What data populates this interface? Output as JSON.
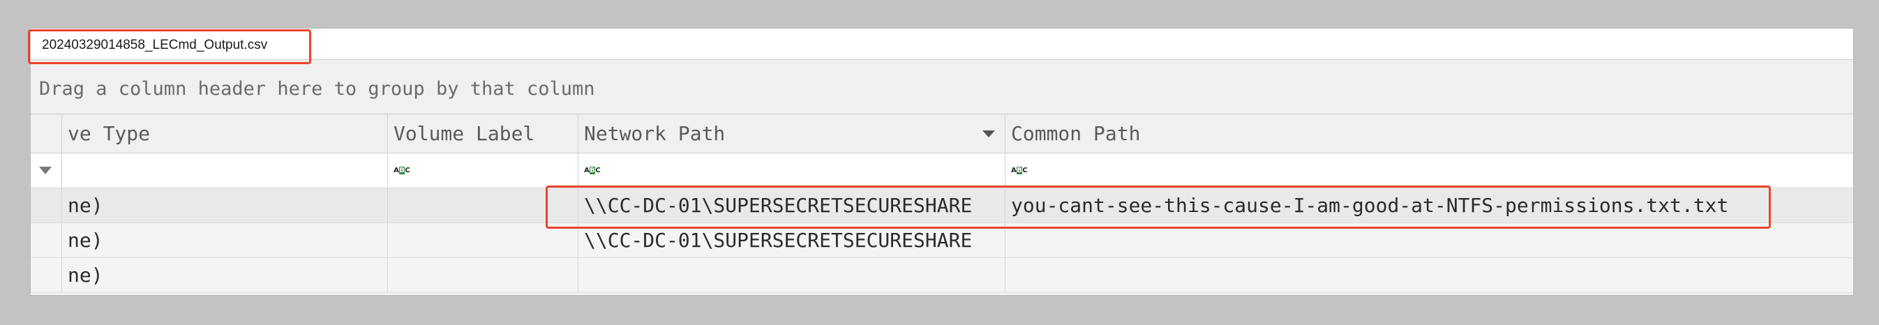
{
  "tab": {
    "filename": "20240329014858_LECmd_Output.csv"
  },
  "group_panel": {
    "text": "Drag a column header here to group by that column"
  },
  "columns": [
    {
      "label": "ve Type"
    },
    {
      "label": "Volume Label",
      "type_badge": "ABC"
    },
    {
      "label": "Network Path",
      "type_badge": "ABC"
    },
    {
      "label": "Common Path",
      "type_badge": "ABC"
    }
  ],
  "rows": [
    {
      "drive_type": "ne)",
      "volume_label": "",
      "network_path": "\\\\CC-DC-01\\SUPERSECRETSECURESHARE",
      "common_path": "you-cant-see-this-cause-I-am-good-at-NTFS-permissions.txt.txt"
    },
    {
      "drive_type": "ne)",
      "volume_label": "",
      "network_path": "\\\\CC-DC-01\\SUPERSECRETSECURESHARE",
      "common_path": ""
    },
    {
      "drive_type": "ne)",
      "volume_label": "",
      "network_path": "",
      "common_path": ""
    }
  ],
  "colors": {
    "highlight": "#e8462c",
    "badge_green": "#2e8b3d"
  }
}
